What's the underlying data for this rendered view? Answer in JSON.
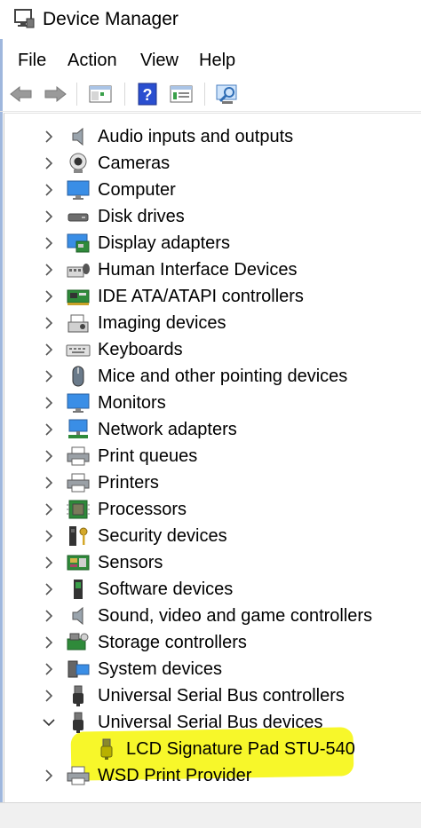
{
  "window": {
    "title": "Device Manager"
  },
  "menu": [
    "File",
    "Action",
    "View",
    "Help"
  ],
  "toolbar": {
    "icons": [
      "back-arrow-icon",
      "forward-arrow-icon",
      "show-hide-console-tree-icon",
      "help-icon",
      "properties-icon",
      "scan-hardware-icon"
    ]
  },
  "tree": {
    "items": [
      {
        "label": "Audio inputs and outputs",
        "icon": "speaker-icon",
        "expanded": false
      },
      {
        "label": "Cameras",
        "icon": "camera-icon",
        "expanded": false
      },
      {
        "label": "Computer",
        "icon": "monitor-icon",
        "expanded": false
      },
      {
        "label": "Disk drives",
        "icon": "disk-drive-icon",
        "expanded": false
      },
      {
        "label": "Display adapters",
        "icon": "display-adapter-icon",
        "expanded": false
      },
      {
        "label": "Human Interface Devices",
        "icon": "hid-icon",
        "expanded": false
      },
      {
        "label": "IDE ATA/ATAPI controllers",
        "icon": "ide-controller-icon",
        "expanded": false
      },
      {
        "label": "Imaging devices",
        "icon": "imaging-icon",
        "expanded": false
      },
      {
        "label": "Keyboards",
        "icon": "keyboard-icon",
        "expanded": false
      },
      {
        "label": "Mice and other pointing devices",
        "icon": "mouse-icon",
        "expanded": false
      },
      {
        "label": "Monitors",
        "icon": "monitor-icon",
        "expanded": false
      },
      {
        "label": "Network adapters",
        "icon": "network-icon",
        "expanded": false
      },
      {
        "label": "Print queues",
        "icon": "printer-icon",
        "expanded": false
      },
      {
        "label": "Printers",
        "icon": "printer-icon",
        "expanded": false
      },
      {
        "label": "Processors",
        "icon": "processor-icon",
        "expanded": false
      },
      {
        "label": "Security devices",
        "icon": "security-icon",
        "expanded": false
      },
      {
        "label": "Sensors",
        "icon": "sensor-icon",
        "expanded": false
      },
      {
        "label": "Software devices",
        "icon": "software-device-icon",
        "expanded": false
      },
      {
        "label": "Sound, video and game controllers",
        "icon": "speaker-icon",
        "expanded": false
      },
      {
        "label": "Storage controllers",
        "icon": "storage-icon",
        "expanded": false
      },
      {
        "label": "System devices",
        "icon": "system-icon",
        "expanded": false
      },
      {
        "label": "Universal Serial Bus controllers",
        "icon": "usb-icon",
        "expanded": false
      },
      {
        "label": "Universal Serial Bus devices",
        "icon": "usb-icon",
        "expanded": true,
        "children": [
          {
            "label": "LCD Signature Pad STU-540",
            "icon": "usb-yellow-icon"
          }
        ]
      },
      {
        "label": "WSD Print Provider",
        "icon": "printer-icon",
        "expanded": false
      }
    ]
  },
  "colors": {
    "highlight": "#f7f72a",
    "icon_blue": "#3a8ee6",
    "usb_yellow": "#c8c000"
  }
}
